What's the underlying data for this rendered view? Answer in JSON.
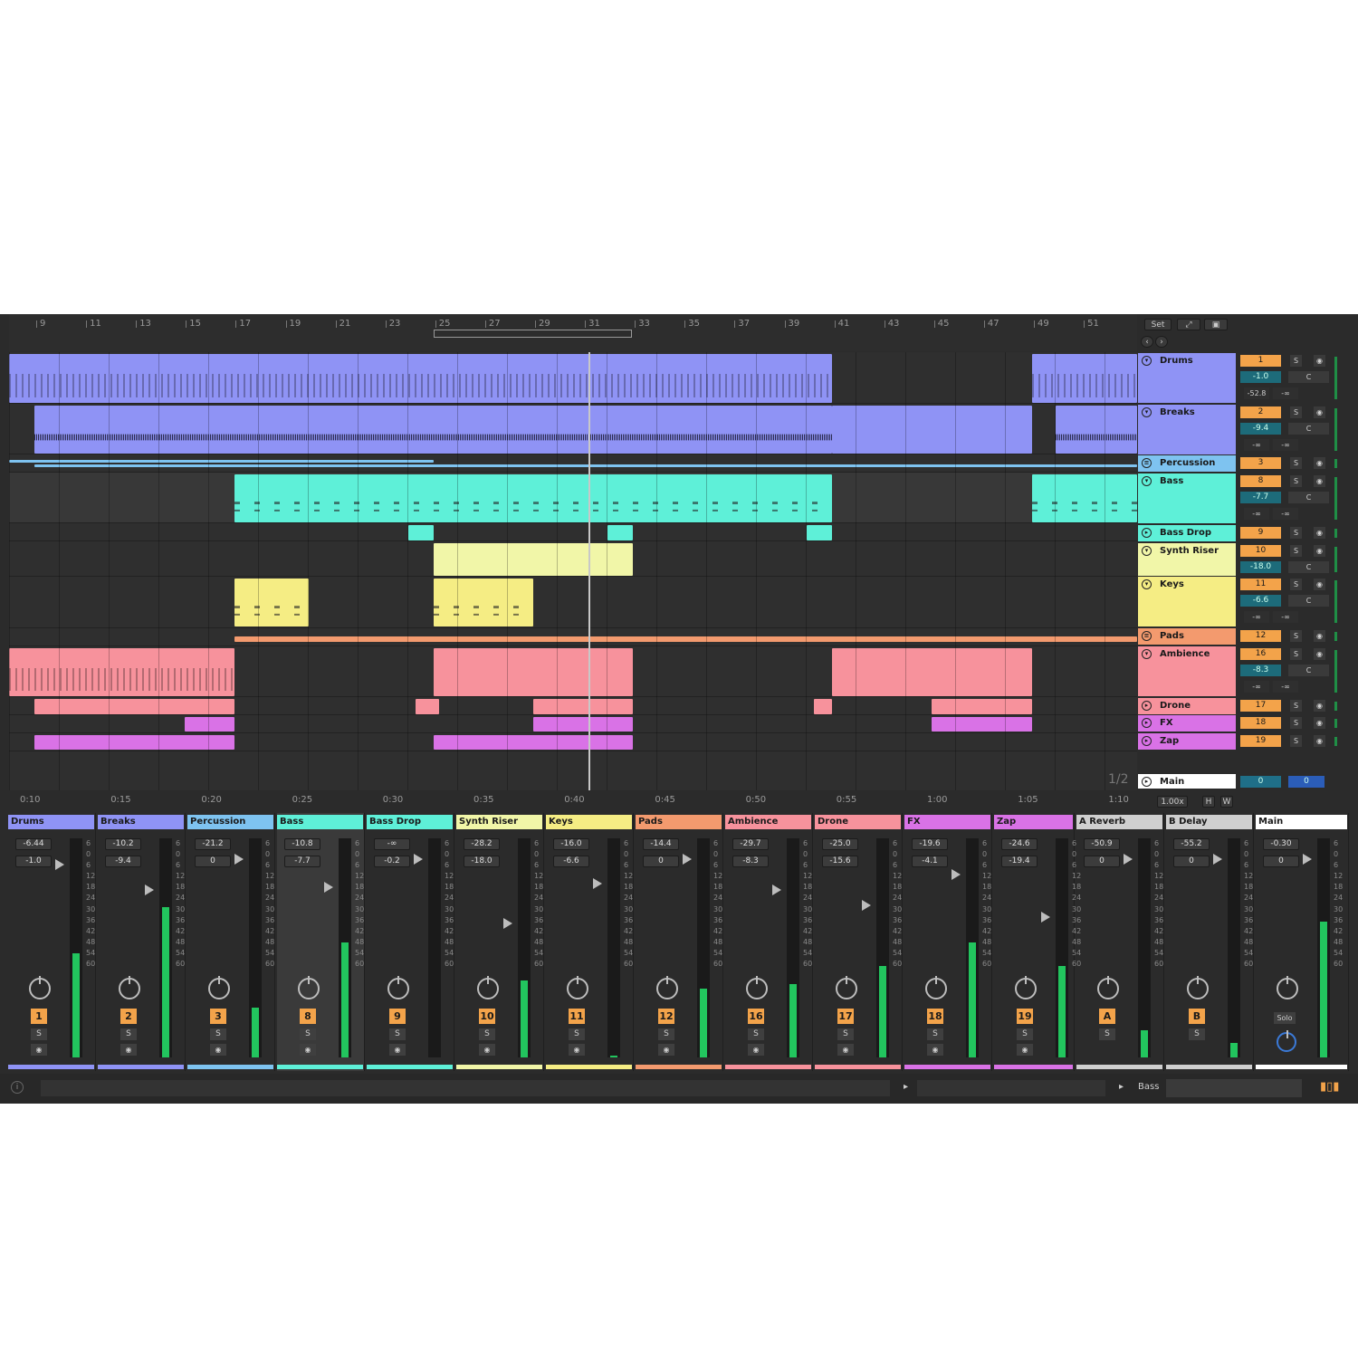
{
  "timeline": {
    "bars": [
      "9",
      "11",
      "13",
      "15",
      "17",
      "19",
      "21",
      "23",
      "25",
      "27",
      "29",
      "31",
      "33",
      "35",
      "37",
      "39",
      "41",
      "43",
      "45",
      "47",
      "49",
      "51"
    ]
  },
  "timescale": [
    "0:10",
    "0:15",
    "0:20",
    "0:25",
    "0:30",
    "0:35",
    "0:40",
    "0:45",
    "0:50",
    "0:55",
    "1:00",
    "1:05",
    "1:10"
  ],
  "page_indicator": "1/2",
  "topright": {
    "set": "Set",
    "zoom": "1.00x",
    "h": "H",
    "w": "W"
  },
  "tracks": [
    {
      "name": "Drums",
      "num": "1",
      "vol": "-1.0",
      "c": "C",
      "in1": "-52.8",
      "in2": "-∞",
      "color": "#8f93f5"
    },
    {
      "name": "Breaks",
      "num": "2",
      "vol": "-9.4",
      "c": "C",
      "in1": "-∞",
      "in2": "-∞",
      "color": "#8f93f5"
    },
    {
      "name": "Percussion",
      "num": "3",
      "color": "#7ec3f0"
    },
    {
      "name": "Bass",
      "num": "8",
      "vol": "-7.7",
      "c": "C",
      "in1": "-∞",
      "in2": "-∞",
      "color": "#5ef0d8"
    },
    {
      "name": "Bass Drop",
      "num": "9",
      "color": "#5ef0d8"
    },
    {
      "name": "Synth Riser",
      "num": "10",
      "vol": "-18.0",
      "c": "C",
      "color": "#f1f6a8"
    },
    {
      "name": "Keys",
      "num": "11",
      "vol": "-6.6",
      "c": "C",
      "in1": "-∞",
      "in2": "-∞",
      "color": "#f5ed84"
    },
    {
      "name": "Pads",
      "num": "12",
      "color": "#f39a6e"
    },
    {
      "name": "Ambience",
      "num": "16",
      "vol": "-8.3",
      "c": "C",
      "in1": "-∞",
      "in2": "-∞",
      "color": "#f7929c"
    },
    {
      "name": "Drone",
      "num": "17",
      "color": "#f7929c"
    },
    {
      "name": "FX",
      "num": "18",
      "color": "#d972e6"
    },
    {
      "name": "Zap",
      "num": "19",
      "color": "#d972e6"
    },
    {
      "name": "Main",
      "num": "0",
      "vol2": "0",
      "color": "#ffffff"
    }
  ],
  "mixer": [
    {
      "name": "Drums",
      "peak": "-6.44",
      "vol": "-1.0",
      "num": "1",
      "solo": "S",
      "color": "#8f93f5",
      "level": 0.5
    },
    {
      "name": "Breaks",
      "peak": "-10.2",
      "vol": "-9.4",
      "num": "2",
      "solo": "S",
      "color": "#8f93f5",
      "level": 0.72
    },
    {
      "name": "Percussion",
      "peak": "-21.2",
      "vol": "0",
      "num": "3",
      "solo": "S",
      "color": "#7ec3f0",
      "level": 0.24
    },
    {
      "name": "Bass",
      "peak": "-10.8",
      "vol": "-7.7",
      "num": "8",
      "solo": "S",
      "color": "#5ef0d8",
      "level": 0.55
    },
    {
      "name": "Bass Drop",
      "peak": "-∞",
      "vol": "-0.2",
      "num": "9",
      "solo": "S",
      "color": "#5ef0d8",
      "level": 0
    },
    {
      "name": "Synth Riser",
      "peak": "-28.2",
      "vol": "-18.0",
      "num": "10",
      "solo": "S",
      "color": "#f1f6a8",
      "level": 0.37
    },
    {
      "name": "Keys",
      "peak": "-16.0",
      "vol": "-6.6",
      "num": "11",
      "solo": "S",
      "color": "#f5ed84",
      "level": 0.01
    },
    {
      "name": "Pads",
      "peak": "-14.4",
      "vol": "0",
      "num": "12",
      "solo": "S",
      "color": "#f39a6e",
      "level": 0.33
    },
    {
      "name": "Ambience",
      "peak": "-29.7",
      "vol": "-8.3",
      "num": "16",
      "solo": "S",
      "color": "#f7929c",
      "level": 0.35
    },
    {
      "name": "Drone",
      "peak": "-25.0",
      "vol": "-15.6",
      "num": "17",
      "solo": "S",
      "color": "#f7929c",
      "level": 0.44
    },
    {
      "name": "FX",
      "peak": "-19.6",
      "vol": "-4.1",
      "num": "18",
      "solo": "S",
      "color": "#d972e6",
      "level": 0.55
    },
    {
      "name": "Zap",
      "peak": "-24.6",
      "vol": "-19.4",
      "num": "19",
      "solo": "S",
      "color": "#d972e6",
      "level": 0.44
    },
    {
      "name": "A Reverb",
      "peak": "-50.9",
      "vol": "0",
      "num": "A",
      "solo": "S",
      "color": "#cfcfcf",
      "level": 0.13
    },
    {
      "name": "B Delay",
      "peak": "-55.2",
      "vol": "0",
      "num": "B",
      "solo": "S",
      "color": "#cfcfcf",
      "level": 0.07
    },
    {
      "name": "Main",
      "peak": "-0.30",
      "vol": "0",
      "num": "Solo",
      "solo": "",
      "color": "#ffffff",
      "level": 0.65
    }
  ],
  "dbscale": [
    "6",
    "0",
    "6",
    "12",
    "18",
    "24",
    "30",
    "36",
    "42",
    "48",
    "54",
    "60"
  ],
  "status": {
    "selected": "Bass"
  }
}
